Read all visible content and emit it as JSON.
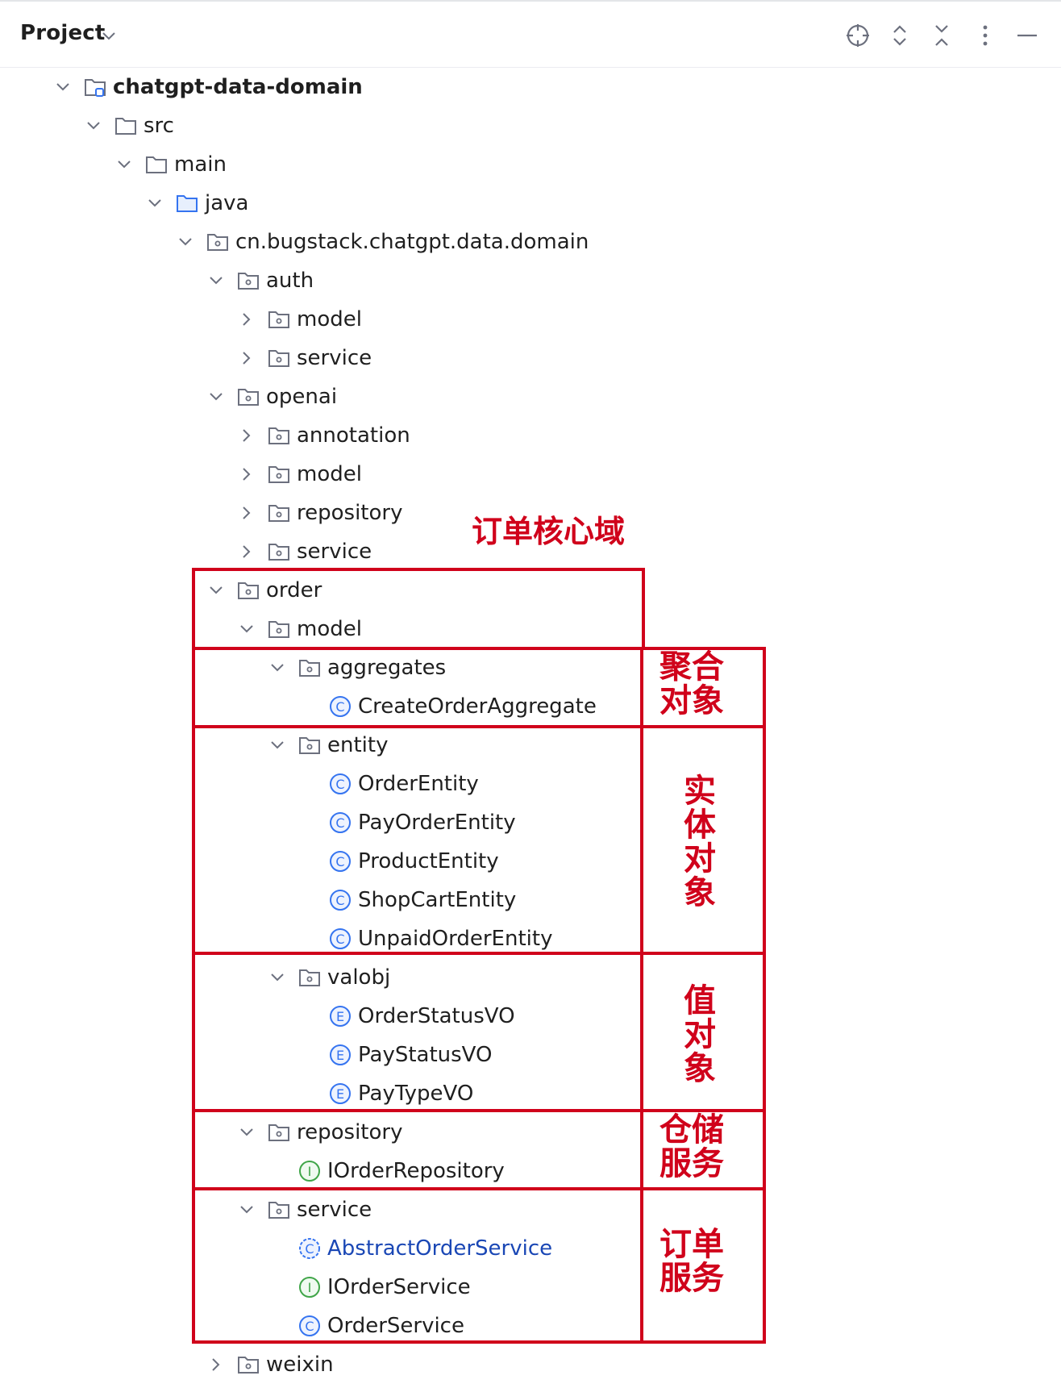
{
  "header": {
    "title": "Project",
    "tools": [
      "locate-icon",
      "expand-collapse-icon",
      "collapse-all-icon",
      "more-options-icon",
      "hide-icon"
    ]
  },
  "tree": [
    {
      "label": "chatgpt-data-domain",
      "depth": 0,
      "expanded": true,
      "icon": "module-folder",
      "bold": true
    },
    {
      "label": "src",
      "depth": 1,
      "expanded": true,
      "icon": "folder"
    },
    {
      "label": "main",
      "depth": 2,
      "expanded": true,
      "icon": "folder"
    },
    {
      "label": "java",
      "depth": 3,
      "expanded": true,
      "icon": "source-folder"
    },
    {
      "label": "cn.bugstack.chatgpt.data.domain",
      "depth": 4,
      "expanded": true,
      "icon": "package"
    },
    {
      "label": "auth",
      "depth": 5,
      "expanded": true,
      "icon": "package"
    },
    {
      "label": "model",
      "depth": 6,
      "expanded": false,
      "icon": "package"
    },
    {
      "label": "service",
      "depth": 6,
      "expanded": false,
      "icon": "package"
    },
    {
      "label": "openai",
      "depth": 5,
      "expanded": true,
      "icon": "package"
    },
    {
      "label": "annotation",
      "depth": 6,
      "expanded": false,
      "icon": "package"
    },
    {
      "label": "model",
      "depth": 6,
      "expanded": false,
      "icon": "package"
    },
    {
      "label": "repository",
      "depth": 6,
      "expanded": false,
      "icon": "package"
    },
    {
      "label": "service",
      "depth": 6,
      "expanded": false,
      "icon": "package"
    },
    {
      "label": "order",
      "depth": 5,
      "expanded": true,
      "icon": "package"
    },
    {
      "label": "model",
      "depth": 6,
      "expanded": true,
      "icon": "package"
    },
    {
      "label": "aggregates",
      "depth": 7,
      "expanded": true,
      "icon": "package"
    },
    {
      "label": "CreateOrderAggregate",
      "depth": 8,
      "icon": "class"
    },
    {
      "label": "entity",
      "depth": 7,
      "expanded": true,
      "icon": "package"
    },
    {
      "label": "OrderEntity",
      "depth": 8,
      "icon": "class"
    },
    {
      "label": "PayOrderEntity",
      "depth": 8,
      "icon": "class"
    },
    {
      "label": "ProductEntity",
      "depth": 8,
      "icon": "class"
    },
    {
      "label": "ShopCartEntity",
      "depth": 8,
      "icon": "class"
    },
    {
      "label": "UnpaidOrderEntity",
      "depth": 8,
      "icon": "class"
    },
    {
      "label": "valobj",
      "depth": 7,
      "expanded": true,
      "icon": "package"
    },
    {
      "label": "OrderStatusVO",
      "depth": 8,
      "icon": "enum"
    },
    {
      "label": "PayStatusVO",
      "depth": 8,
      "icon": "enum"
    },
    {
      "label": "PayTypeVO",
      "depth": 8,
      "icon": "enum"
    },
    {
      "label": "repository",
      "depth": 6,
      "expanded": true,
      "icon": "package"
    },
    {
      "label": "IOrderRepository",
      "depth": 7,
      "icon": "interface"
    },
    {
      "label": "service",
      "depth": 6,
      "expanded": true,
      "icon": "package"
    },
    {
      "label": "AbstractOrderService",
      "depth": 7,
      "icon": "abstract-class",
      "abstract": true
    },
    {
      "label": "IOrderService",
      "depth": 7,
      "icon": "interface"
    },
    {
      "label": "OrderService",
      "depth": 7,
      "icon": "class"
    },
    {
      "label": "weixin",
      "depth": 5,
      "expanded": false,
      "icon": "package"
    }
  ],
  "annotations": {
    "order_domain": "订单核心域",
    "aggregate": [
      "聚合",
      "对象"
    ],
    "entity": [
      "实",
      "体",
      "对",
      "象"
    ],
    "value_object": [
      "值",
      "对",
      "象"
    ],
    "repository": [
      "仓储",
      "服务"
    ],
    "order_service": [
      "订单",
      "服务"
    ]
  },
  "colors": {
    "annotation": "#d0021b",
    "class_icon": "#3574f0",
    "interface_icon": "#3fa548",
    "abstract_label": "#1a47b5",
    "folder_icon": "#6c707e",
    "source_folder_icon": "#3574f0"
  }
}
